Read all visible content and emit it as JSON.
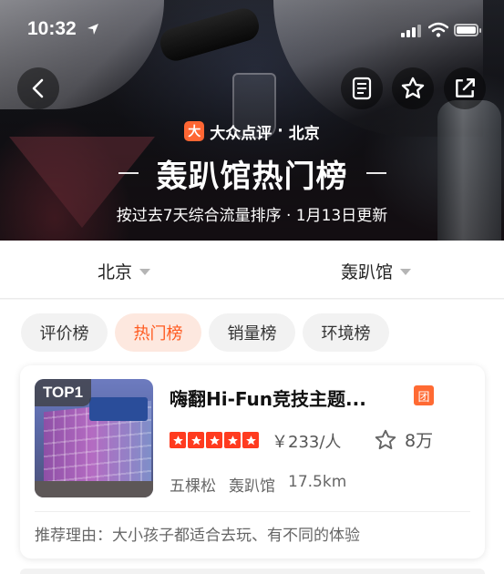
{
  "status_bar": {
    "time": "10:32"
  },
  "hero": {
    "brand_name": "大众点评",
    "brand_logo_char": "大",
    "city_sep": "·",
    "city": "北京",
    "title": "轰趴馆热门榜",
    "subtitle": "按过去7天综合流量排序 · 1月13日更新"
  },
  "filters": {
    "city": "北京",
    "category": "轰趴馆"
  },
  "tabs": [
    {
      "label": "评价榜",
      "active": false
    },
    {
      "label": "热门榜",
      "active": true
    },
    {
      "label": "销量榜",
      "active": false
    },
    {
      "label": "环境榜",
      "active": false
    }
  ],
  "card": {
    "rank_badge": "TOP1",
    "name": "嗨翻Hi-Fun竞技主题...",
    "tag": "团",
    "rating_stars": 5,
    "price": "￥233/人",
    "favorites": "8万",
    "district": "五棵松",
    "category": "轰趴馆",
    "distance": "17.5km",
    "reason": "推荐理由：大小孩子都适合去玩、有不同的体验"
  },
  "colors": {
    "accent": "#ff5a1f",
    "star": "#ff3b1f",
    "tab_active_bg": "#fde8df"
  },
  "icons": [
    "back-icon",
    "list-icon",
    "star-outline-icon",
    "share-icon",
    "location-arrow-icon",
    "wifi-icon",
    "signal-icon",
    "battery-icon",
    "caret-down-icon"
  ]
}
